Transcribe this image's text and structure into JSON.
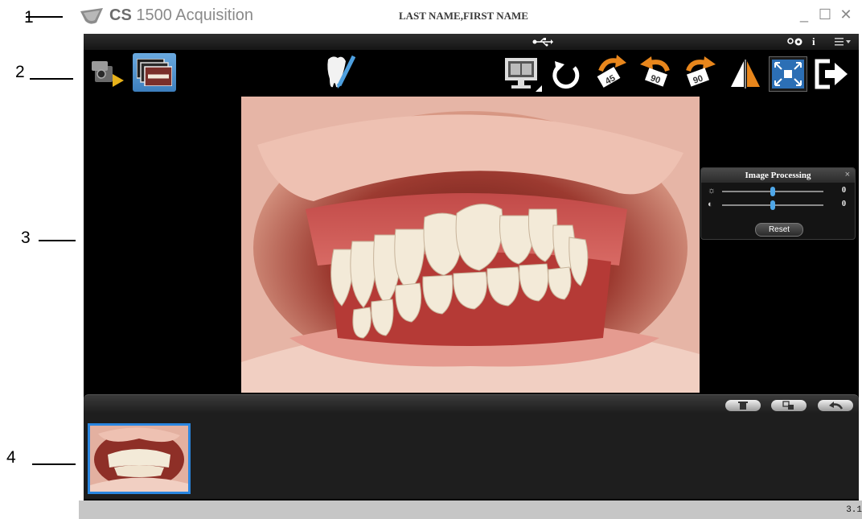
{
  "callouts": [
    "1",
    "2",
    "3",
    "4"
  ],
  "titlebar": {
    "logo_icon": "cs-logo-icon",
    "brand": "CS",
    "app_name": "1500 Acquisition",
    "patient_name": "LAST NAME,FIRST NAME",
    "minimize": "_",
    "maximize": "☐",
    "close": "✕"
  },
  "top_strip": {
    "usb_icon": "usb-icon",
    "settings_icon": "settings-icon",
    "info": "i",
    "menu_icon": "menu-icon"
  },
  "toolbar": {
    "left_tools": [
      "acquisition-mode-icon",
      "image-gallery-icon"
    ],
    "center_tool": "tooth-annotation-icon",
    "right_tools": [
      "display-monitor-icon",
      "rotate-icon",
      "rotate-45-icon",
      "rotate-ccw-90-icon",
      "rotate-cw-90-icon",
      "mirror-icon",
      "fullscreen-icon",
      "exit-icon"
    ],
    "rotate_45_label": "45",
    "rotate_ccw_label": "90",
    "rotate_cw_label": "90"
  },
  "image_processing": {
    "title": "Image Processing",
    "close": "×",
    "brightness_icon": "brightness-icon",
    "brightness_value": "0",
    "brightness_level": 0.5,
    "contrast_icon": "contrast-icon",
    "contrast_value": "0",
    "contrast_level": 0.5,
    "reset_label": "Reset"
  },
  "thumbnail_bar": {
    "buttons": [
      "delete-icon",
      "copy-icon",
      "undo-icon"
    ]
  },
  "thumbnails": {
    "count": 1,
    "selected_index": 0
  },
  "statusbar": {
    "version": "3.1"
  },
  "colors": {
    "selection_blue": "#2a86e0",
    "slider_blue": "#4fa7e8",
    "rotate_orange": "#e8861c"
  }
}
